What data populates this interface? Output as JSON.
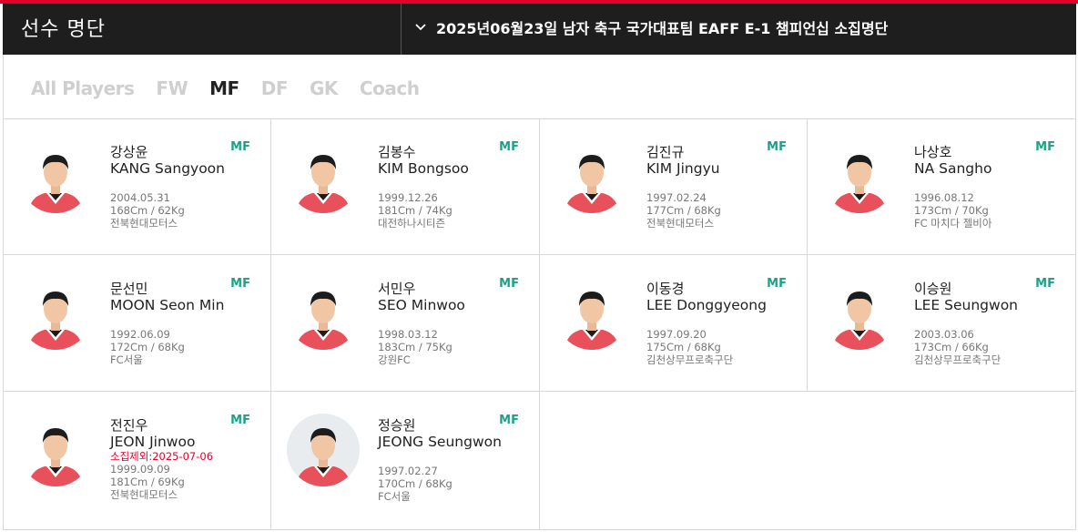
{
  "header": {
    "title": "선수 명단",
    "squad_selector": "2025년06월23일 남자 축구 국가대표팀 EAFF E-1 챔피언십 소집명단",
    "chevron_icon": "chevron-down-icon"
  },
  "tabs": [
    {
      "label": "All Players",
      "active": false
    },
    {
      "label": "FW",
      "active": false
    },
    {
      "label": "MF",
      "active": true
    },
    {
      "label": "DF",
      "active": false
    },
    {
      "label": "GK",
      "active": false
    },
    {
      "label": "Coach",
      "active": false
    }
  ],
  "colors": {
    "accent": "#e4002b",
    "position_badge": "#1aa287",
    "header_bg": "#1e1e1e"
  },
  "players": [
    {
      "name_ko": "강상윤",
      "name_en": "KANG Sangyoon",
      "position": "MF",
      "note": "",
      "birth": "2004.05.31",
      "body": "168Cm / 62Kg",
      "club": "전북현대모터스"
    },
    {
      "name_ko": "김봉수",
      "name_en": "KIM Bongsoo",
      "position": "MF",
      "note": "",
      "birth": "1999.12.26",
      "body": "181Cm / 74Kg",
      "club": "대전하나시티즌"
    },
    {
      "name_ko": "김진규",
      "name_en": "KIM Jingyu",
      "position": "MF",
      "note": "",
      "birth": "1997.02.24",
      "body": "177Cm / 68Kg",
      "club": "전북현대모터스"
    },
    {
      "name_ko": "나상호",
      "name_en": "NA Sangho",
      "position": "MF",
      "note": "",
      "birth": "1996.08.12",
      "body": "173Cm / 70Kg",
      "club": "FC 마치다 젤비아"
    },
    {
      "name_ko": "문선민",
      "name_en": "MOON Seon Min",
      "position": "MF",
      "note": "",
      "birth": "1992.06.09",
      "body": "172Cm / 68Kg",
      "club": "FC서울"
    },
    {
      "name_ko": "서민우",
      "name_en": "SEO Minwoo",
      "position": "MF",
      "note": "",
      "birth": "1998.03.12",
      "body": "183Cm / 75Kg",
      "club": "강원FC"
    },
    {
      "name_ko": "이동경",
      "name_en": "LEE Donggyeong",
      "position": "MF",
      "note": "",
      "birth": "1997.09.20",
      "body": "175Cm / 68Kg",
      "club": "김천상무프로축구단"
    },
    {
      "name_ko": "이승원",
      "name_en": "LEE Seungwon",
      "position": "MF",
      "note": "",
      "birth": "2003.03.06",
      "body": "173Cm / 66Kg",
      "club": "김천상무프로축구단"
    },
    {
      "name_ko": "전진우",
      "name_en": "JEON Jinwoo",
      "position": "MF",
      "note": "소집제외:2025-07-06",
      "birth": "1999.09.09",
      "body": "181Cm / 69Kg",
      "club": "전북현대모터스"
    },
    {
      "name_ko": "정승원",
      "name_en": "JEONG Seungwon",
      "position": "MF",
      "note": "",
      "birth": "1997.02.27",
      "body": "170Cm / 68Kg",
      "club": "FC서울"
    }
  ]
}
